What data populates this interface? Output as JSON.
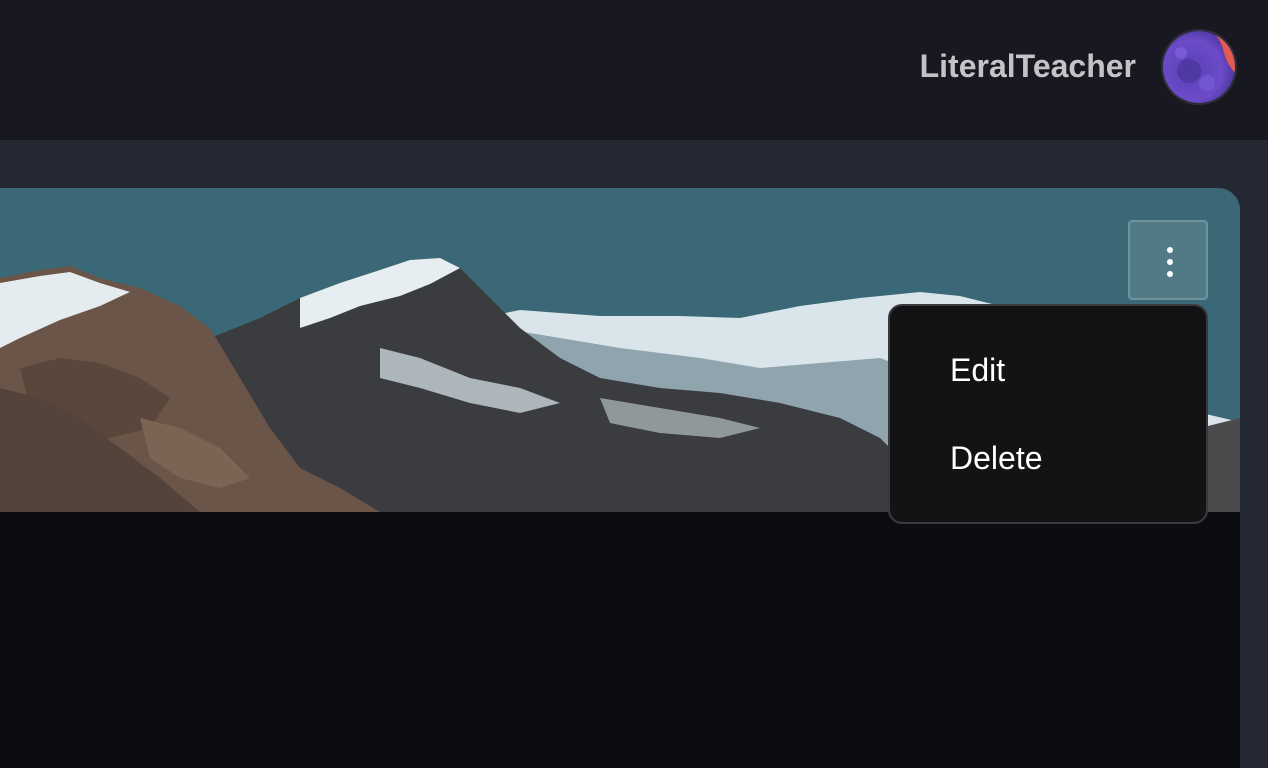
{
  "header": {
    "username": "LiteralTeacher",
    "avatar_icon": "avatar-icon"
  },
  "card": {
    "banner_icon": "mountain-image",
    "menu_button_icon": "more-vertical-icon"
  },
  "dropdown": {
    "items": [
      {
        "label": "Edit"
      },
      {
        "label": "Delete"
      }
    ]
  },
  "colors": {
    "topbar": "#181920",
    "page_background": "#242833",
    "card_background": "#0c0d10",
    "sky": "#3a6877",
    "dropdown_background": "#131214"
  }
}
